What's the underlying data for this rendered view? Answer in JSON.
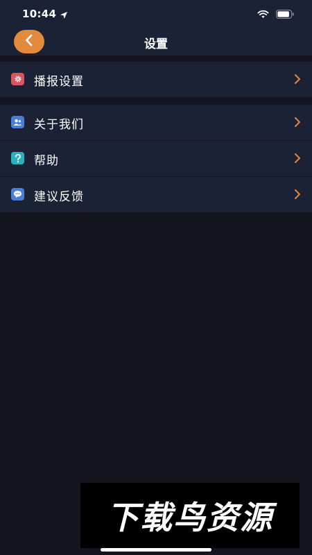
{
  "status_bar": {
    "time": "10:44",
    "icons": [
      "location-arrow-icon",
      "wifi-icon",
      "battery-icon"
    ]
  },
  "nav": {
    "title": "设置",
    "back_icon": "chevron-left-icon",
    "accent_color": "#e38a3d"
  },
  "groups": [
    {
      "items": [
        {
          "label": "播报设置",
          "icon": "gear-icon",
          "icon_color": "#d9545e"
        }
      ]
    },
    {
      "items": [
        {
          "label": "关于我们",
          "icon": "users-icon",
          "icon_color": "#4a7fd6"
        },
        {
          "label": "帮助",
          "icon": "question-icon",
          "icon_color": "#2ab0c0"
        },
        {
          "label": "建议反馈",
          "icon": "chat-bubble-icon",
          "icon_color": "#4a7fd6"
        }
      ]
    }
  ],
  "chevron_color": "#e38a3d",
  "watermark": {
    "text": "下载鸟资源"
  }
}
